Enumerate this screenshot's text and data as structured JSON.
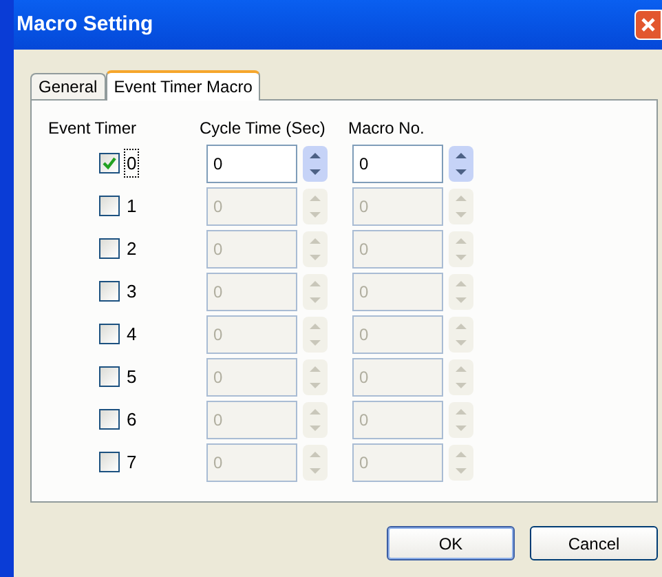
{
  "window": {
    "title": "Macro Setting"
  },
  "tabs": [
    {
      "label": "General",
      "selected": false
    },
    {
      "label": "Event Timer Macro",
      "selected": true
    }
  ],
  "columns": [
    "Event Timer",
    "Cycle Time (Sec)",
    "Macro No."
  ],
  "rows": [
    {
      "label": "0",
      "checked": true,
      "focused": true,
      "cycle_time": "0",
      "macro_no": "0"
    },
    {
      "label": "1",
      "checked": false,
      "focused": false,
      "cycle_time": "0",
      "macro_no": "0"
    },
    {
      "label": "2",
      "checked": false,
      "focused": false,
      "cycle_time": "0",
      "macro_no": "0"
    },
    {
      "label": "3",
      "checked": false,
      "focused": false,
      "cycle_time": "0",
      "macro_no": "0"
    },
    {
      "label": "4",
      "checked": false,
      "focused": false,
      "cycle_time": "0",
      "macro_no": "0"
    },
    {
      "label": "5",
      "checked": false,
      "focused": false,
      "cycle_time": "0",
      "macro_no": "0"
    },
    {
      "label": "6",
      "checked": false,
      "focused": false,
      "cycle_time": "0",
      "macro_no": "0"
    },
    {
      "label": "7",
      "checked": false,
      "focused": false,
      "cycle_time": "0",
      "macro_no": "0"
    }
  ],
  "buttons": [
    "OK",
    "Cancel"
  ]
}
